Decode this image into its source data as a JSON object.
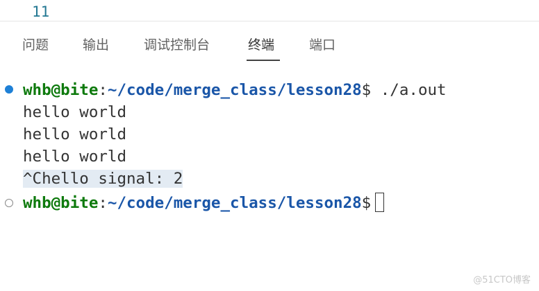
{
  "editor": {
    "line_number": "11"
  },
  "panel": {
    "tabs": [
      {
        "label": "问题"
      },
      {
        "label": "输出"
      },
      {
        "label": "调试控制台"
      },
      {
        "label": "终端",
        "active": true
      },
      {
        "label": "端口"
      }
    ]
  },
  "terminal": {
    "prompt_user": "whb@bite",
    "prompt_colon": ":",
    "prompt_path": "~/code/merge_class/lesson28",
    "prompt_dollar": "$",
    "command": " ./a.out",
    "output": [
      "hello world",
      "hello world",
      "hello world",
      "^Chello signal: 2"
    ]
  },
  "watermark": "@51CTO博客",
  "colors": {
    "prompt_user": "#0e7a0d",
    "prompt_path": "#1a56a8",
    "success_dot": "#1e80d6",
    "idle_dot": "#8a8a8a"
  }
}
